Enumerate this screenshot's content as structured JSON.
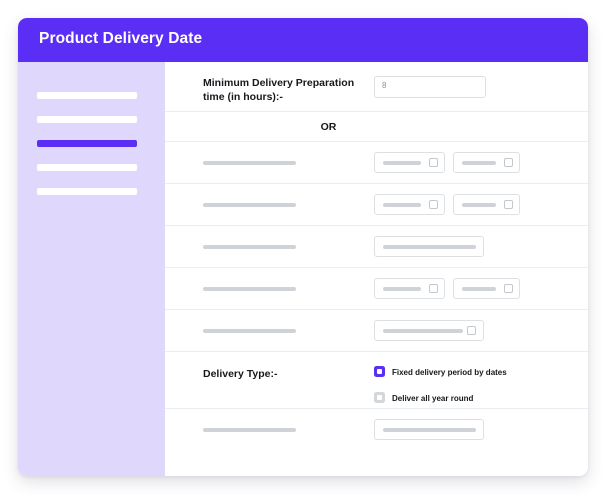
{
  "theme": {
    "accent": "#5B2EF5",
    "sidebar_bg": "#DFD8FC",
    "card_bg": "#FFFFFF",
    "skeleton_gray": "#CFD2D6",
    "divider": "#E9EEF3",
    "text": "#17181C"
  },
  "header": {
    "title": "Product Delivery Date"
  },
  "sidebar": {
    "items": [
      {
        "name": "nav-item-1",
        "state": "default"
      },
      {
        "name": "nav-item-2",
        "state": "default"
      },
      {
        "name": "nav-item-3",
        "state": "active"
      },
      {
        "name": "nav-item-4",
        "state": "default"
      },
      {
        "name": "nav-item-5",
        "state": "default"
      }
    ]
  },
  "form": {
    "prep_time": {
      "label": "Minimum Delivery Preparation time (in hours):-",
      "value": "8"
    },
    "or_divider": {
      "label": "OR"
    },
    "skeleton_rows": [
      {
        "name": "skeleton-row-1",
        "inputs": 2,
        "icon": true
      },
      {
        "name": "skeleton-row-2",
        "inputs": 2,
        "icon": true
      },
      {
        "name": "skeleton-row-3",
        "inputs": 1,
        "icon": false
      },
      {
        "name": "skeleton-row-4",
        "inputs": 2,
        "icon": true
      },
      {
        "name": "skeleton-row-5",
        "inputs": 1,
        "icon": true
      }
    ],
    "delivery_type": {
      "label": "Delivery Type:-",
      "options": [
        {
          "label": "Fixed delivery period by dates",
          "selected": true
        },
        {
          "label": "Deliver all year round",
          "selected": false
        }
      ]
    },
    "last_row": {
      "name": "skeleton-row-6"
    }
  }
}
